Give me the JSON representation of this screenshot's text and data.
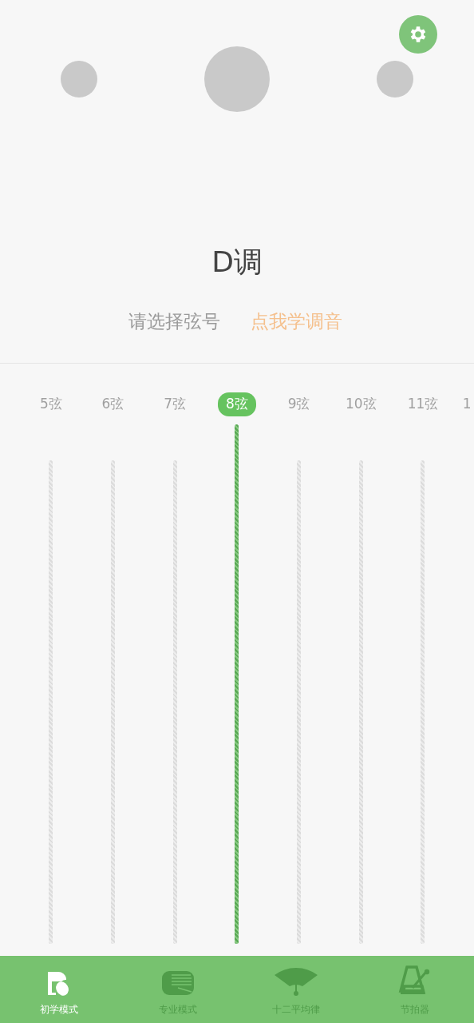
{
  "header": {
    "key_title": "D调",
    "prompt": "请选择弦号",
    "learn_link": "点我学调音"
  },
  "strings": [
    {
      "label": "5弦",
      "selected": false,
      "kind": "full"
    },
    {
      "label": "6弦",
      "selected": false,
      "kind": "full"
    },
    {
      "label": "7弦",
      "selected": false,
      "kind": "full"
    },
    {
      "label": "8弦",
      "selected": true,
      "kind": "full"
    },
    {
      "label": "9弦",
      "selected": false,
      "kind": "full"
    },
    {
      "label": "10弦",
      "selected": false,
      "kind": "full"
    },
    {
      "label": "11弦",
      "selected": false,
      "kind": "full"
    },
    {
      "label": "1",
      "selected": false,
      "kind": "partial"
    }
  ],
  "bottom_nav": [
    {
      "label": "初学模式",
      "selected": true,
      "kind": "beginner"
    },
    {
      "label": "专业模式",
      "selected": false,
      "kind": "pro"
    },
    {
      "label": "十二平均律",
      "selected": false,
      "kind": "temperament"
    },
    {
      "label": "节拍器",
      "selected": false,
      "kind": "metronome"
    }
  ]
}
